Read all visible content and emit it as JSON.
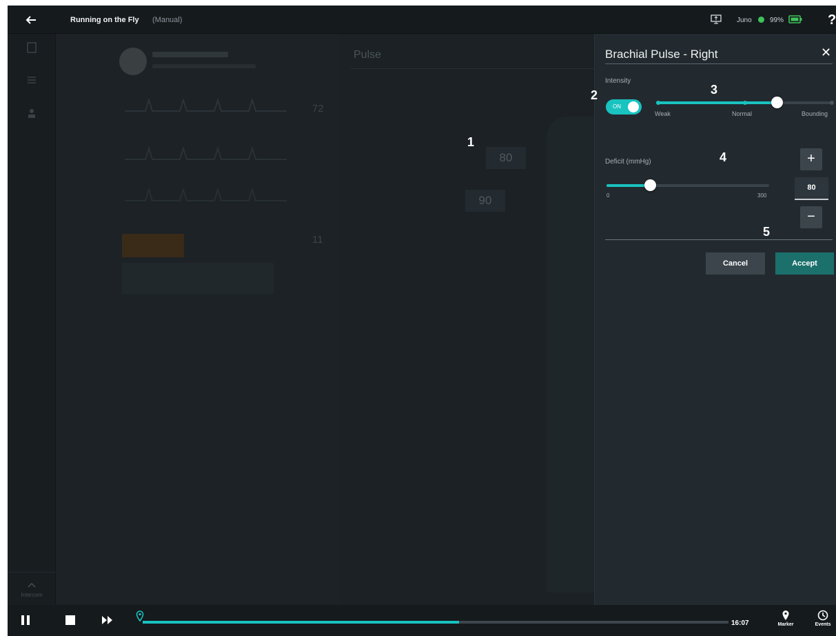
{
  "topbar": {
    "title": "Running on the Fly",
    "mode": "(Manual)",
    "device_name": "Juno",
    "battery": "99%",
    "help": "?"
  },
  "left_rail": {
    "intercom_label": "Intercom"
  },
  "body_area": {
    "title": "Pulse",
    "bp_top": "80",
    "bp_bottom": "90"
  },
  "vitals": {
    "values": [
      "72",
      "11"
    ]
  },
  "panel": {
    "title": "Brachial Pulse - Right",
    "close": "✕",
    "intensity_label": "Intensity",
    "toggle_label": "ON",
    "intensity_stops": [
      "Weak",
      "Normal",
      "Bounding"
    ],
    "intensity_value_fraction": 0.68,
    "deficit_label": "Deficit (mmHg)",
    "deficit_min": "0",
    "deficit_max": "300",
    "deficit_value": "80",
    "plus": "+",
    "minus": "−",
    "cancel": "Cancel",
    "accept": "Accept"
  },
  "callouts": [
    "1",
    "2",
    "3",
    "4",
    "5"
  ],
  "bottombar": {
    "time": "16:07",
    "timeline_progress": 0.54,
    "marker_label": "Marker",
    "events_label": "Events"
  },
  "colors": {
    "accent": "#19c3c0",
    "accept": "#1b706c",
    "status_green": "#3fc25a"
  },
  "icons": [
    "back-arrow-icon",
    "screen-share-icon",
    "battery-icon",
    "pause-icon",
    "stop-icon",
    "fast-forward-icon",
    "location-pin-icon",
    "clock-icon",
    "chevron-up-icon"
  ]
}
